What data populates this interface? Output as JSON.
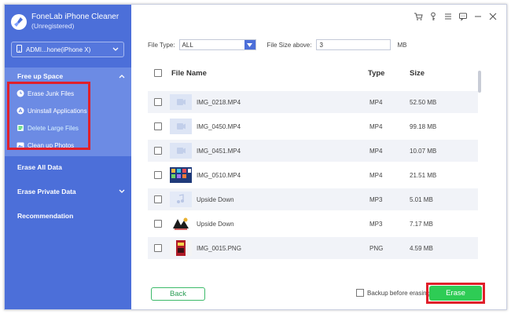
{
  "app": {
    "title": "FoneLab iPhone Cleaner",
    "subtitle": "(Unregistered)",
    "brand_color": "#4c6fd9"
  },
  "device": {
    "name": "ADMI...hone(iPhone X)"
  },
  "sidebar": {
    "sections": [
      {
        "label": "Free up Space",
        "expanded": true,
        "items": [
          {
            "label": "Erase Junk Files",
            "icon": "clock-icon",
            "active": false
          },
          {
            "label": "Uninstall Applications",
            "icon": "app-store-icon",
            "active": false
          },
          {
            "label": "Delete Large Files",
            "icon": "file-icon",
            "active": true
          },
          {
            "label": "Clean up Photos",
            "icon": "photo-icon",
            "active": false
          }
        ]
      },
      {
        "label": "Erase All Data"
      },
      {
        "label": "Erase Private Data",
        "has_chevron": true
      },
      {
        "label": "Recommendation"
      }
    ]
  },
  "filters": {
    "file_type_label": "File Type:",
    "file_type_value": "ALL",
    "size_label": "File Size above:",
    "size_value": "3",
    "size_unit": "MB"
  },
  "table": {
    "columns": {
      "name": "File Name",
      "type": "Type",
      "size": "Size"
    },
    "rows": [
      {
        "name": "IMG_0218.MP4",
        "type": "MP4",
        "size": "52.50 MB",
        "thumb": "video"
      },
      {
        "name": "IMG_0450.MP4",
        "type": "MP4",
        "size": "99.18 MB",
        "thumb": "video"
      },
      {
        "name": "IMG_0451.MP4",
        "type": "MP4",
        "size": "10.07 MB",
        "thumb": "video"
      },
      {
        "name": "IMG_0510.MP4",
        "type": "MP4",
        "size": "21.51 MB",
        "thumb": "apps"
      },
      {
        "name": "Upside Down",
        "type": "MP3",
        "size": "5.01 MB",
        "thumb": "music"
      },
      {
        "name": "Upside Down",
        "type": "MP3",
        "size": "7.17 MB",
        "thumb": "art"
      },
      {
        "name": "IMG_0015.PNG",
        "type": "PNG",
        "size": "4.59 MB",
        "thumb": "poster"
      }
    ]
  },
  "footer": {
    "back_label": "Back",
    "backup_label": "Backup before erasing",
    "erase_label": "Erase"
  }
}
